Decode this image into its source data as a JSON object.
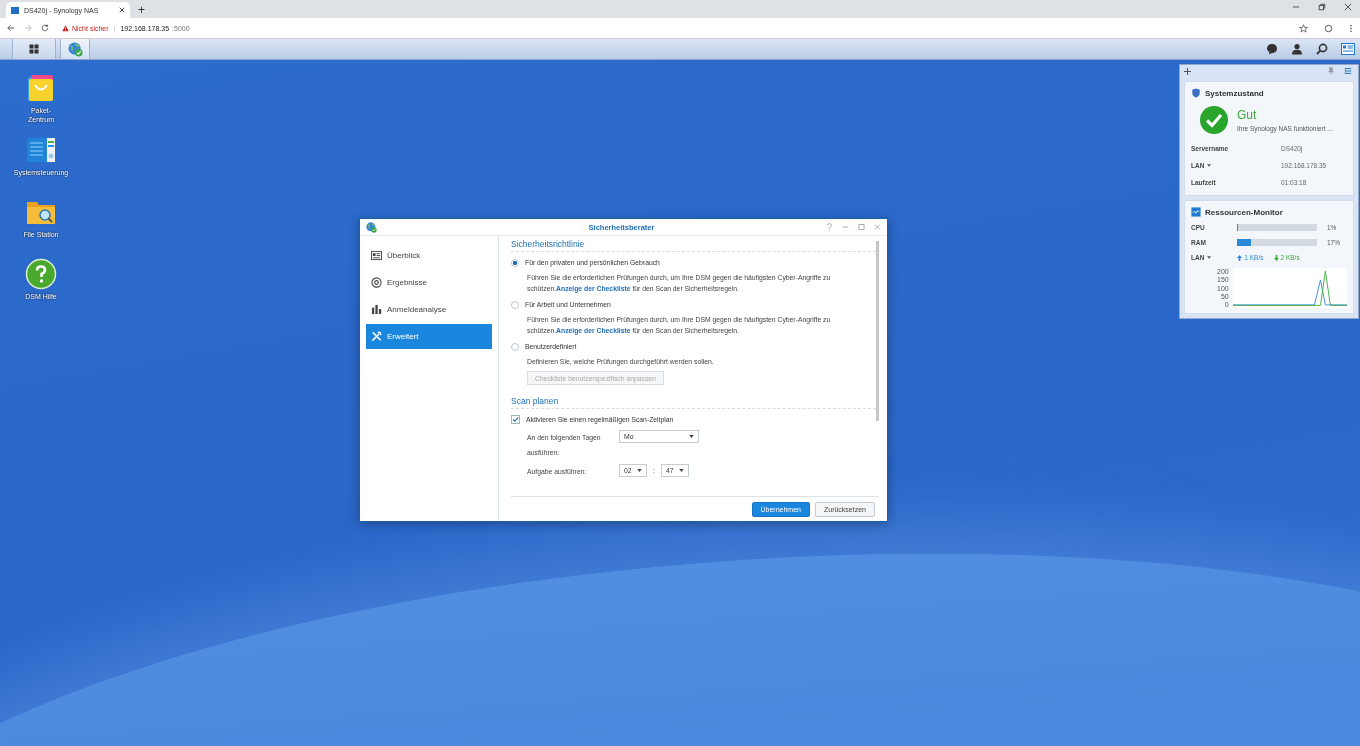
{
  "browser": {
    "tab_title": "DS420j - Synology NAS",
    "new_tab": "+",
    "address": {
      "warning": "Nicht sicher",
      "separator": "|",
      "host": "192.168.178.35",
      "port": ":5000"
    }
  },
  "desktop_icons": [
    {
      "kind": "package",
      "label": "Paket-\nZentrum"
    },
    {
      "kind": "control",
      "label": "Systemsteuerung"
    },
    {
      "kind": "folder",
      "label": "File Station"
    },
    {
      "kind": "help",
      "label": "DSM Hilfe"
    }
  ],
  "system_status": {
    "title": "Systemzustand",
    "status": "Gut",
    "message": "Ihre Synology NAS funktioniert ...",
    "rows": [
      {
        "label": "Servername",
        "value": "DS420j",
        "dropdown": false
      },
      {
        "label": "LAN",
        "value": "192.168.178.35",
        "dropdown": true
      },
      {
        "label": "Laufzeit",
        "value": "01:03:18",
        "dropdown": false
      }
    ]
  },
  "resource_monitor": {
    "title": "Ressourcen-Monitor",
    "meters": [
      {
        "label": "CPU",
        "level": 0.01,
        "reading": "1%"
      },
      {
        "label": "RAM",
        "level": 0.17,
        "reading": "17%"
      }
    ],
    "lan": {
      "label": "LAN",
      "up": "1 KB/s",
      "down": "2 KB/s"
    },
    "graph_axis_labels": [
      "200",
      "150",
      "100",
      "50",
      "0"
    ]
  },
  "dialog": {
    "title": "Sicherheitsberater",
    "nav": [
      {
        "label": "Überblick",
        "selected": false
      },
      {
        "label": "Ergebnisse",
        "selected": false
      },
      {
        "label": "Anmeldeanalyse",
        "selected": false
      },
      {
        "label": "Erweitert",
        "selected": true
      }
    ],
    "policy": {
      "title": "Sicherheitsrichtlinie",
      "options": [
        {
          "label": "Für den privaten und persönlichen Gebrauch",
          "selected": true,
          "text": "Führen Sie die erforderlichen Prüfungen durch, um Ihre DSM gegen die häufigsten Cyber-Angriffe zu schützen.",
          "link": "Anzeige der Checkliste",
          "text_after": "für den Scan der Sicherheitsregeln."
        },
        {
          "label": "Für Arbeit und Unternehmen",
          "selected": false,
          "text": "Führen Sie die erforderlichen Prüfungen durch, um Ihre DSM gegen die häufigsten Cyber-Angriffe zu schützen.",
          "link": "Anzeige der Checkliste",
          "text_after": "für den Scan der Sicherheitsregeln."
        },
        {
          "label": "Benutzerdefiniert",
          "selected": false,
          "text": "Definieren Sie, welche Prüfungen durchgeführt werden sollen.",
          "button": {
            "label": "Checkliste benutzerspezifisch anpassen",
            "disabled": true
          }
        }
      ]
    },
    "schedule": {
      "title": "Scan planen",
      "checkbox": {
        "label": "Aktivieren Sie einen regelmäßigen Scan-Zeitplan",
        "checked": true
      },
      "days_label": "An den folgenden Tagen ausführen:",
      "days_value": "Mo",
      "time_label": "Aufgabe ausführen:",
      "hour": "02",
      "separator": ":",
      "minute": "47"
    },
    "buttons": [
      {
        "kind": "primary",
        "label": "Übernehmen"
      },
      {
        "kind": "secondary",
        "label": "Zurücksetzen"
      }
    ]
  }
}
